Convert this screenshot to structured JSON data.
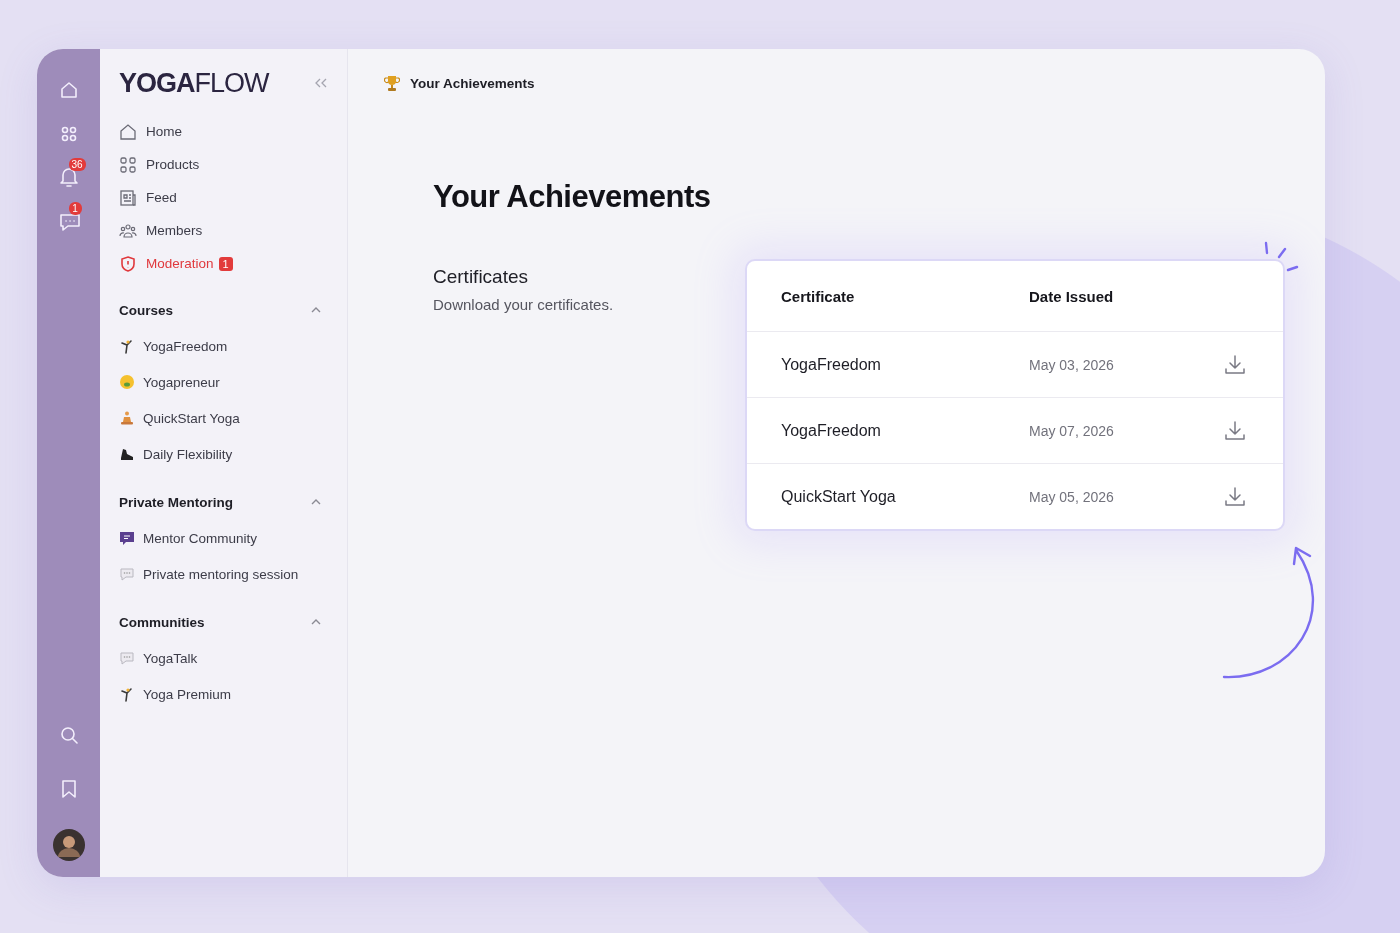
{
  "rail_top": [
    {
      "kind": "home"
    },
    {
      "kind": "apps"
    },
    {
      "kind": "notifications",
      "badge": "36"
    },
    {
      "kind": "messages",
      "badge": "1"
    }
  ],
  "rail_bottom": [
    {
      "kind": "search"
    },
    {
      "kind": "bookmarks"
    },
    {
      "kind": "avatar"
    }
  ],
  "logo": "**YOGA**FLOW",
  "nav": [
    {
      "label": "Home",
      "kind": "link"
    },
    {
      "label": "Products",
      "kind": "link"
    },
    {
      "label": "Feed",
      "kind": "link"
    },
    {
      "label": "Members",
      "kind": "link"
    },
    {
      "label": "Moderation",
      "kind": "alert",
      "badge": "1"
    }
  ],
  "sections": [
    {
      "title": "Courses",
      "expanded": true,
      "items": [
        "YogaFreedom",
        "Yogapreneur",
        "QuickStart Yoga",
        "Daily Flexibility"
      ]
    },
    {
      "title": "Private Mentoring",
      "expanded": true,
      "items": [
        "Mentor Community",
        "Private mentoring session"
      ]
    },
    {
      "title": "Communities",
      "expanded": true,
      "items": [
        "YogaTalk",
        "Yoga Premium"
      ]
    }
  ],
  "breadcrumb": "Your Achievements",
  "heading": "Your Achievements",
  "certificates": {
    "title": "Certificates",
    "subtitle": "Download your certificates.",
    "columns": [
      "Certificate",
      "Date Issued"
    ],
    "rows": [
      {
        "name": "YogaFreedom",
        "date": "May 03, 2026"
      },
      {
        "name": "YogaFreedom",
        "date": "May 07, 2026"
      },
      {
        "name": "QuickStart Yoga",
        "date": "May 05, 2026"
      }
    ]
  }
}
